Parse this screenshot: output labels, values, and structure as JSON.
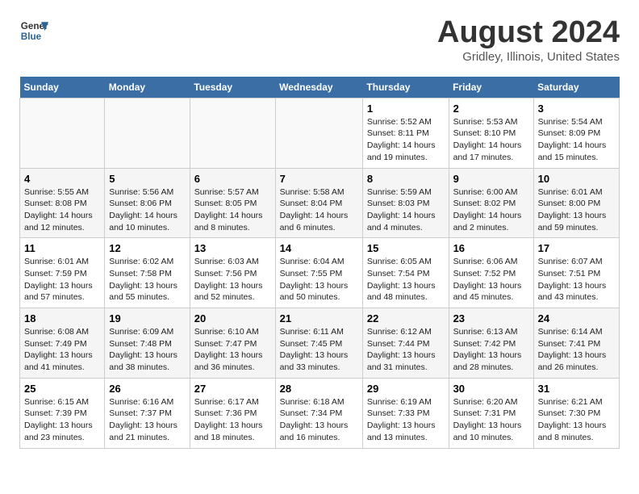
{
  "header": {
    "logo_line1": "General",
    "logo_line2": "Blue",
    "main_title": "August 2024",
    "subtitle": "Gridley, Illinois, United States"
  },
  "columns": [
    "Sunday",
    "Monday",
    "Tuesday",
    "Wednesday",
    "Thursday",
    "Friday",
    "Saturday"
  ],
  "weeks": [
    {
      "days": [
        {
          "num": "",
          "info": ""
        },
        {
          "num": "",
          "info": ""
        },
        {
          "num": "",
          "info": ""
        },
        {
          "num": "",
          "info": ""
        },
        {
          "num": "1",
          "info": "Sunrise: 5:52 AM\nSunset: 8:11 PM\nDaylight: 14 hours\nand 19 minutes."
        },
        {
          "num": "2",
          "info": "Sunrise: 5:53 AM\nSunset: 8:10 PM\nDaylight: 14 hours\nand 17 minutes."
        },
        {
          "num": "3",
          "info": "Sunrise: 5:54 AM\nSunset: 8:09 PM\nDaylight: 14 hours\nand 15 minutes."
        }
      ]
    },
    {
      "days": [
        {
          "num": "4",
          "info": "Sunrise: 5:55 AM\nSunset: 8:08 PM\nDaylight: 14 hours\nand 12 minutes."
        },
        {
          "num": "5",
          "info": "Sunrise: 5:56 AM\nSunset: 8:06 PM\nDaylight: 14 hours\nand 10 minutes."
        },
        {
          "num": "6",
          "info": "Sunrise: 5:57 AM\nSunset: 8:05 PM\nDaylight: 14 hours\nand 8 minutes."
        },
        {
          "num": "7",
          "info": "Sunrise: 5:58 AM\nSunset: 8:04 PM\nDaylight: 14 hours\nand 6 minutes."
        },
        {
          "num": "8",
          "info": "Sunrise: 5:59 AM\nSunset: 8:03 PM\nDaylight: 14 hours\nand 4 minutes."
        },
        {
          "num": "9",
          "info": "Sunrise: 6:00 AM\nSunset: 8:02 PM\nDaylight: 14 hours\nand 2 minutes."
        },
        {
          "num": "10",
          "info": "Sunrise: 6:01 AM\nSunset: 8:00 PM\nDaylight: 13 hours\nand 59 minutes."
        }
      ]
    },
    {
      "days": [
        {
          "num": "11",
          "info": "Sunrise: 6:01 AM\nSunset: 7:59 PM\nDaylight: 13 hours\nand 57 minutes."
        },
        {
          "num": "12",
          "info": "Sunrise: 6:02 AM\nSunset: 7:58 PM\nDaylight: 13 hours\nand 55 minutes."
        },
        {
          "num": "13",
          "info": "Sunrise: 6:03 AM\nSunset: 7:56 PM\nDaylight: 13 hours\nand 52 minutes."
        },
        {
          "num": "14",
          "info": "Sunrise: 6:04 AM\nSunset: 7:55 PM\nDaylight: 13 hours\nand 50 minutes."
        },
        {
          "num": "15",
          "info": "Sunrise: 6:05 AM\nSunset: 7:54 PM\nDaylight: 13 hours\nand 48 minutes."
        },
        {
          "num": "16",
          "info": "Sunrise: 6:06 AM\nSunset: 7:52 PM\nDaylight: 13 hours\nand 45 minutes."
        },
        {
          "num": "17",
          "info": "Sunrise: 6:07 AM\nSunset: 7:51 PM\nDaylight: 13 hours\nand 43 minutes."
        }
      ]
    },
    {
      "days": [
        {
          "num": "18",
          "info": "Sunrise: 6:08 AM\nSunset: 7:49 PM\nDaylight: 13 hours\nand 41 minutes."
        },
        {
          "num": "19",
          "info": "Sunrise: 6:09 AM\nSunset: 7:48 PM\nDaylight: 13 hours\nand 38 minutes."
        },
        {
          "num": "20",
          "info": "Sunrise: 6:10 AM\nSunset: 7:47 PM\nDaylight: 13 hours\nand 36 minutes."
        },
        {
          "num": "21",
          "info": "Sunrise: 6:11 AM\nSunset: 7:45 PM\nDaylight: 13 hours\nand 33 minutes."
        },
        {
          "num": "22",
          "info": "Sunrise: 6:12 AM\nSunset: 7:44 PM\nDaylight: 13 hours\nand 31 minutes."
        },
        {
          "num": "23",
          "info": "Sunrise: 6:13 AM\nSunset: 7:42 PM\nDaylight: 13 hours\nand 28 minutes."
        },
        {
          "num": "24",
          "info": "Sunrise: 6:14 AM\nSunset: 7:41 PM\nDaylight: 13 hours\nand 26 minutes."
        }
      ]
    },
    {
      "days": [
        {
          "num": "25",
          "info": "Sunrise: 6:15 AM\nSunset: 7:39 PM\nDaylight: 13 hours\nand 23 minutes."
        },
        {
          "num": "26",
          "info": "Sunrise: 6:16 AM\nSunset: 7:37 PM\nDaylight: 13 hours\nand 21 minutes."
        },
        {
          "num": "27",
          "info": "Sunrise: 6:17 AM\nSunset: 7:36 PM\nDaylight: 13 hours\nand 18 minutes."
        },
        {
          "num": "28",
          "info": "Sunrise: 6:18 AM\nSunset: 7:34 PM\nDaylight: 13 hours\nand 16 minutes."
        },
        {
          "num": "29",
          "info": "Sunrise: 6:19 AM\nSunset: 7:33 PM\nDaylight: 13 hours\nand 13 minutes."
        },
        {
          "num": "30",
          "info": "Sunrise: 6:20 AM\nSunset: 7:31 PM\nDaylight: 13 hours\nand 10 minutes."
        },
        {
          "num": "31",
          "info": "Sunrise: 6:21 AM\nSunset: 7:30 PM\nDaylight: 13 hours\nand 8 minutes."
        }
      ]
    }
  ]
}
